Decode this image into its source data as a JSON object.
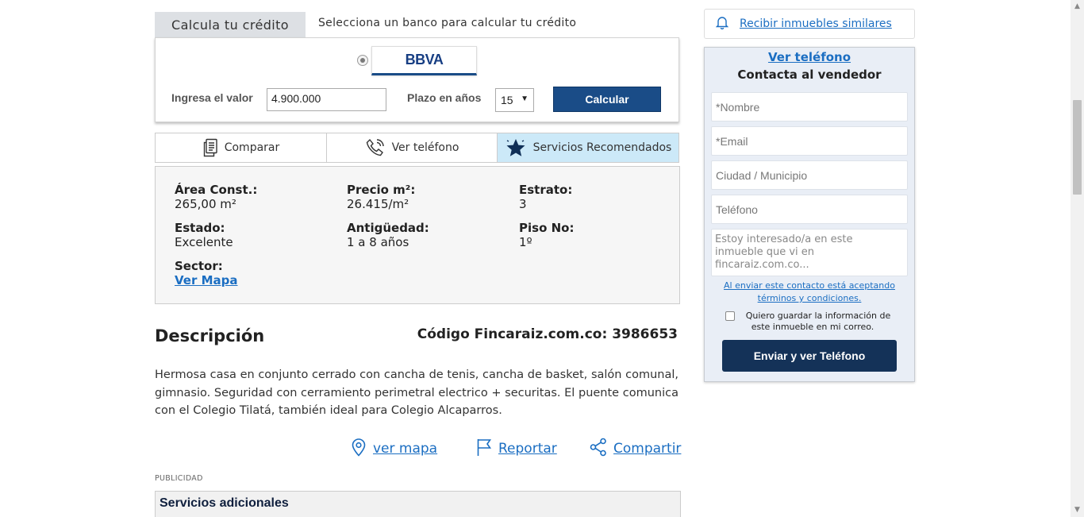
{
  "credit": {
    "tab_label": "Calcula tu crédito",
    "hint": "Selecciona un banco para calcular tu crédito",
    "bank_name": "BBVA",
    "value_label": "Ingresa el valor",
    "value": "4.900.000",
    "term_label": "Plazo en años",
    "term_value": "15",
    "calc_button": "Calcular"
  },
  "actions": {
    "compare": "Comparar",
    "phone": "Ver teléfono",
    "services": "Servicios Recomendados"
  },
  "features": {
    "area_label": "Área Const.:",
    "area_value": "265,00 m²",
    "price_m2_label": "Precio m²:",
    "price_m2_value": "26.415/m²",
    "estrato_label": "Estrato:",
    "estrato_value": "3",
    "estado_label": "Estado:",
    "estado_value": "Excelente",
    "antiguedad_label": "Antigüedad:",
    "antiguedad_value": "1 a 8 años",
    "piso_label": "Piso No:",
    "piso_value": "1º",
    "sector_label": "Sector:",
    "sector_link": "Ver Mapa"
  },
  "description": {
    "title": "Descripción",
    "code": "Código Fincaraiz.com.co: 3986653",
    "text": "Hermosa casa en conjunto cerrado con cancha de tenis, cancha de basket, salón comunal, gimnasio. Seguridad con cerramiento perimetral electrico + securitas. El puente comunica con el Colegio Tilatá, también ideal para Colegio Alcaparros."
  },
  "links": {
    "map": "ver mapa",
    "report": "Reportar",
    "share": "Compartir"
  },
  "ads": {
    "label": "PUBLICIDAD",
    "services_title": "Servicios adicionales"
  },
  "sidebar": {
    "similar": "Recibir inmuebles similares",
    "phone_link": "Ver teléfono",
    "contact_title": "Contacta al vendedor",
    "name_placeholder": "*Nombre",
    "email_placeholder": "*Email",
    "city_placeholder": "Ciudad / Municipio",
    "phone_placeholder": "Teléfono",
    "message_placeholder": "Estoy interesado/a en este inmueble que vi en fincaraiz.com.co...",
    "terms_line1": "Al enviar este contacto está aceptando",
    "terms_line2": "términos y condiciones.",
    "save_label": "Quiero guardar la información de este inmueble en mi correo.",
    "send_button": "Enviar y ver Teléfono"
  },
  "colors": {
    "accent_blue": "#1a4c87",
    "link_blue": "#1b6ec2",
    "dark_navy": "#143258",
    "tab_highlight": "#cce9f8"
  }
}
